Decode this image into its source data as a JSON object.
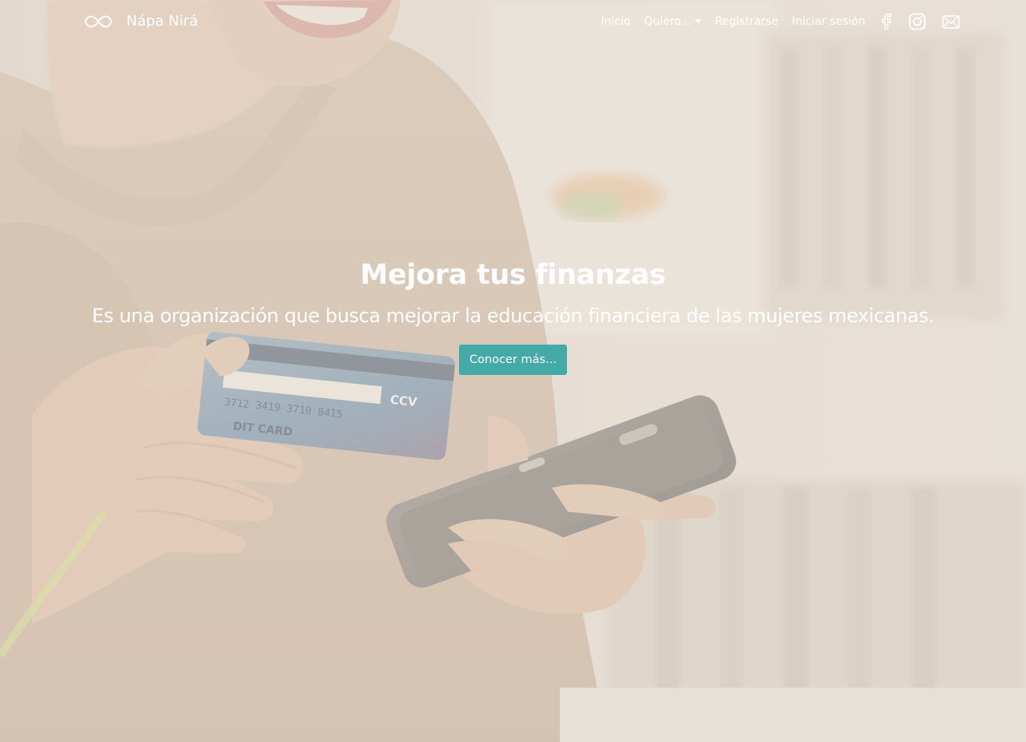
{
  "brand": {
    "name": "Nápa Nirá",
    "logo_icon": "infinity-icon"
  },
  "nav": {
    "items": [
      {
        "label": "Inicio"
      },
      {
        "label": "Quiero...",
        "dropdown": true
      },
      {
        "label": "Registrarse"
      },
      {
        "label": "Iniciar sesión"
      }
    ],
    "social": [
      "facebook-icon",
      "instagram-icon",
      "envelope-icon"
    ]
  },
  "hero": {
    "title": "Mejora tus finanzas",
    "subtitle": "Es una organización que busca mejorar la educación financiera de las mujeres mexicanas.",
    "cta_label": "Conocer más...",
    "background_image": "Woman in beige sweater holding a credit card and a smartphone, with a faded light overlay",
    "credit_card_text": {
      "ccv": "CCV",
      "card_label": "DIT CARD"
    }
  },
  "colors": {
    "accent": "#44aaa8",
    "text": "#ffffff",
    "overlay": "#efe6dc"
  }
}
